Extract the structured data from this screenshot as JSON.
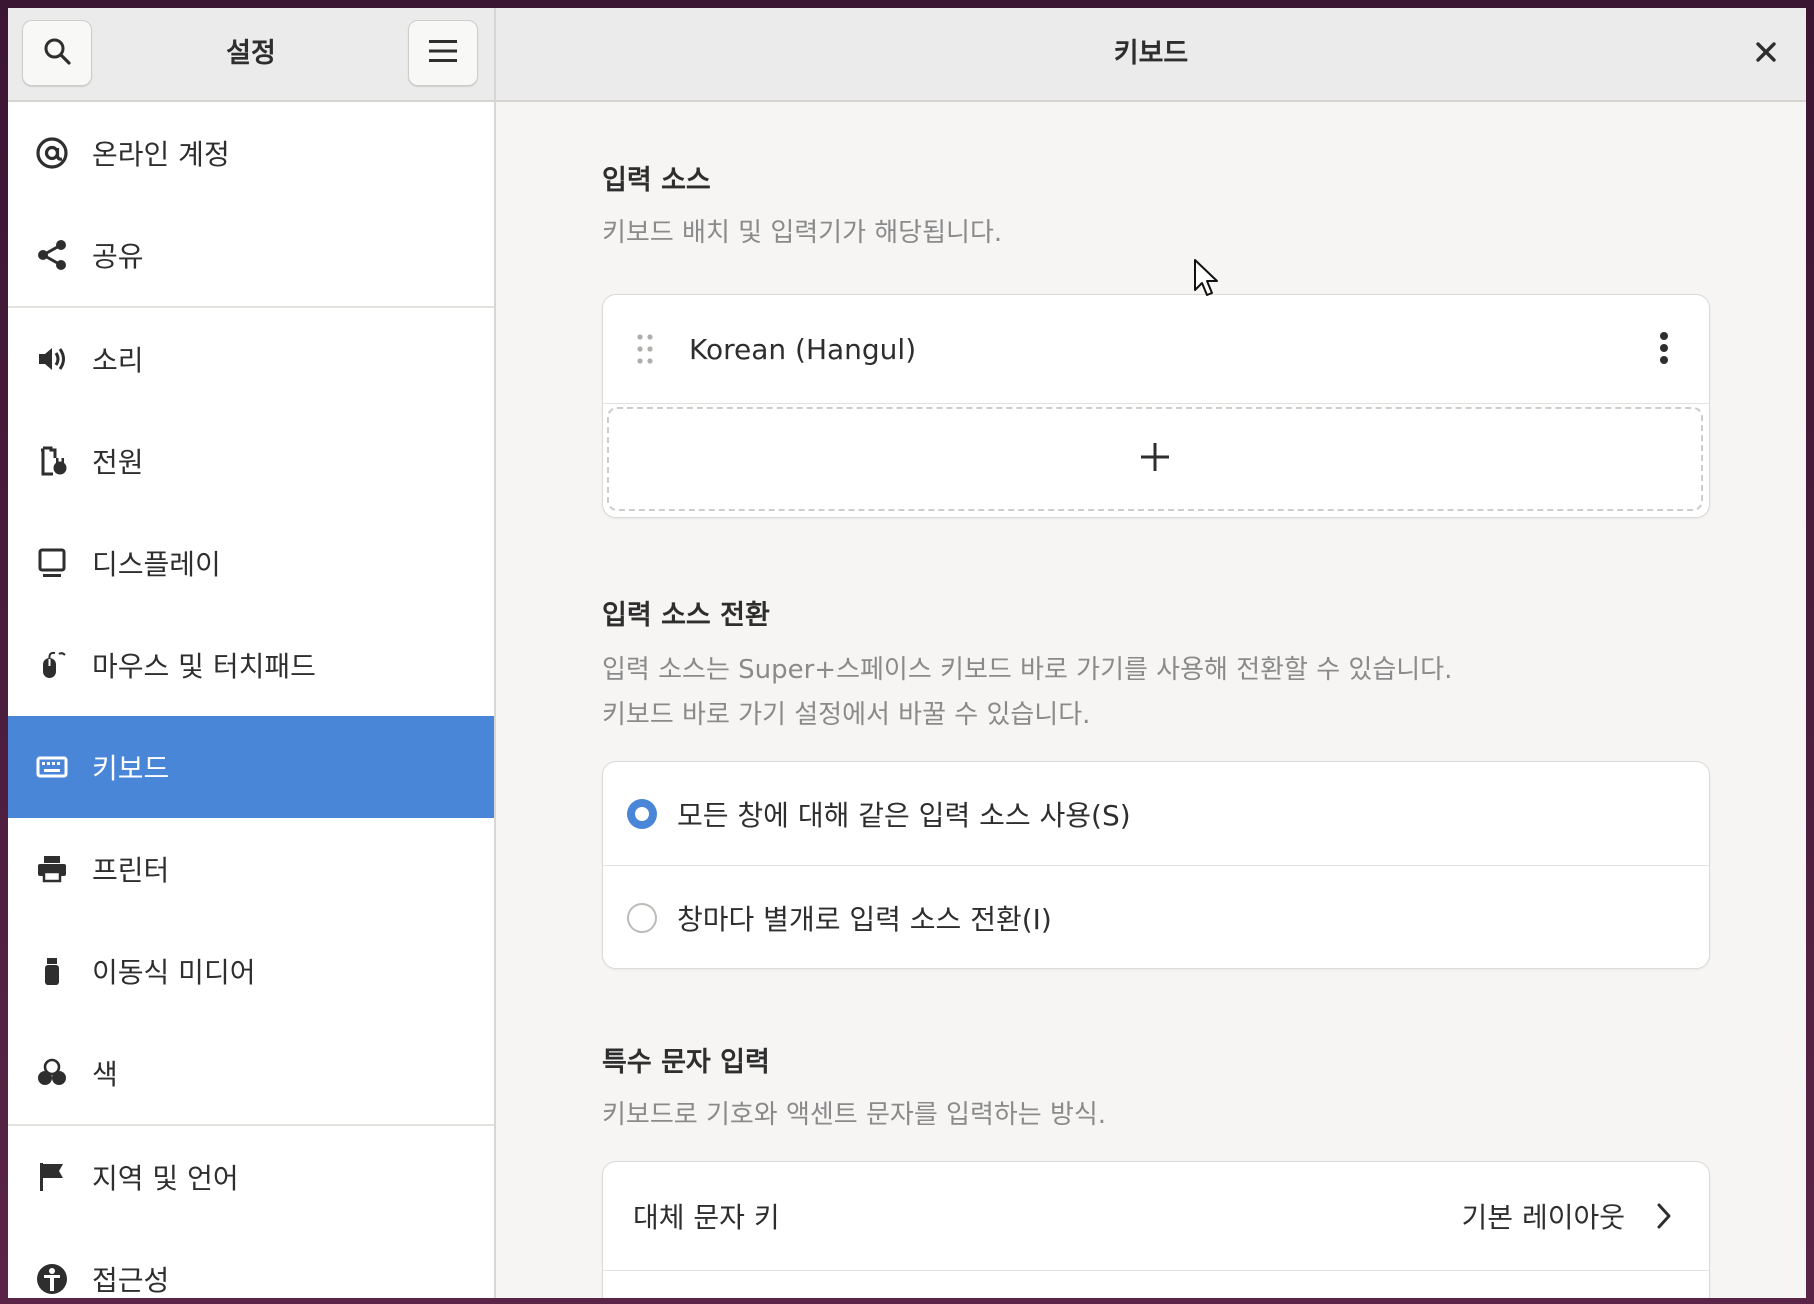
{
  "sidebar": {
    "title": "설정",
    "items": [
      {
        "label": "온라인 계정",
        "icon": "at-icon"
      },
      {
        "label": "공유",
        "icon": "share-icon"
      },
      {
        "label": "소리",
        "icon": "speaker-icon"
      },
      {
        "label": "전원",
        "icon": "battery-icon"
      },
      {
        "label": "디스플레이",
        "icon": "display-icon"
      },
      {
        "label": "마우스 및 터치패드",
        "icon": "mouse-icon"
      },
      {
        "label": "키보드",
        "icon": "keyboard-icon",
        "active": true
      },
      {
        "label": "프린터",
        "icon": "printer-icon"
      },
      {
        "label": "이동식 미디어",
        "icon": "usb-icon"
      },
      {
        "label": "색",
        "icon": "color-icon"
      },
      {
        "label": "지역 및 언어",
        "icon": "flag-icon"
      },
      {
        "label": "접근성",
        "icon": "accessibility-icon"
      }
    ]
  },
  "content": {
    "title": "키보드",
    "input_sources": {
      "title": "입력 소스",
      "description": "키보드 배치 및 입력기가 해당됩니다.",
      "items": [
        "Korean (Hangul)"
      ],
      "add_label": "+"
    },
    "switching": {
      "title": "입력 소스 전환",
      "description_line1": "입력 소스는 Super+스페이스 키보드 바로 가기를 사용해 전환할 수 있습니다.",
      "description_line2": "키보드 바로 가기 설정에서 바꿀 수 있습니다.",
      "options": [
        {
          "label": "모든 창에 대해 같은 입력 소스 사용(S)",
          "selected": true
        },
        {
          "label": "창마다 별개로 입력 소스 전환(I)",
          "selected": false
        }
      ]
    },
    "special": {
      "title": "특수 문자 입력",
      "description": "키보드로 기호와 액센트 문자를 입력하는 방식.",
      "rows": [
        {
          "label": "대체 문자 키",
          "value": "기본 레이아웃"
        }
      ]
    }
  },
  "colors": {
    "accent": "#4a86d8"
  }
}
